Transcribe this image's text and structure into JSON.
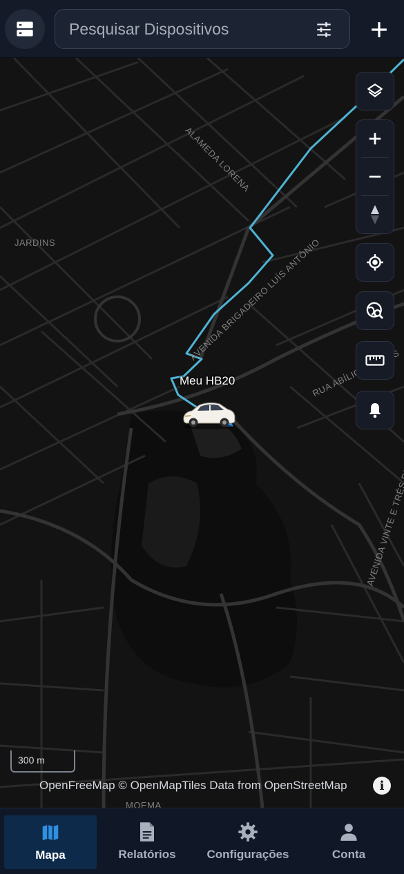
{
  "header": {
    "search_placeholder": "Pesquisar Dispositivos",
    "menu_icon": "server-list-icon",
    "filter_icon": "tune-icon",
    "add_icon": "plus-icon"
  },
  "map": {
    "vehicle_name": "Meu HB20",
    "scale_label": "300 m",
    "attribution": "OpenFreeMap © OpenMapTiles Data from OpenStreetMap",
    "street_labels": {
      "alameda_lorena": "ALAMEDA LORENA",
      "jardins": "JARDINS",
      "av_antonio": "AVENIDA BRIGADEIRO LUÍS ANTÔNIO",
      "rua_abilio": "RUA ABÍLIO SOARES",
      "av_maio": "AVENIDA VINTE E TRÊS DE MAIO",
      "moema": "MOEMA"
    },
    "route_color": "#4fb3d4",
    "controls": [
      "layers-icon",
      "zoom-in-icon",
      "zoom-out-icon",
      "compass-icon",
      "my-location-icon",
      "geofence-search-icon",
      "ruler-icon",
      "bell-icon"
    ]
  },
  "nav": {
    "items": [
      {
        "label": "Mapa",
        "icon": "map-icon",
        "active": true
      },
      {
        "label": "Relatórios",
        "icon": "document-icon",
        "active": false
      },
      {
        "label": "Configurações",
        "icon": "gear-icon",
        "active": false
      },
      {
        "label": "Conta",
        "icon": "person-icon",
        "active": false
      }
    ]
  },
  "colors": {
    "accent": "#2f8fe0",
    "topbar": "#141a28",
    "nav_active": "#0d2a4a"
  }
}
